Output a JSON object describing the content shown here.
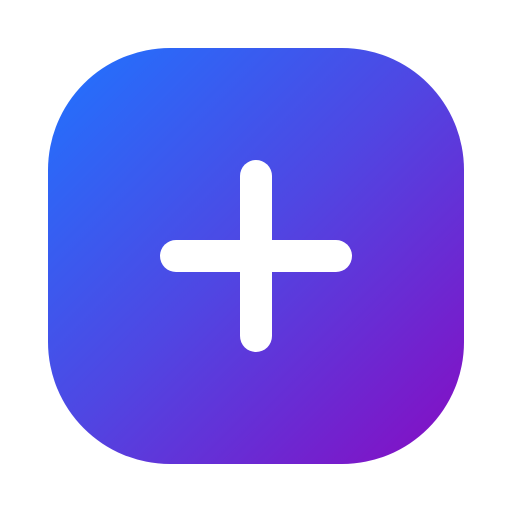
{
  "icon": {
    "name": "plus-icon",
    "gradient_start": "#1F74FF",
    "gradient_mid": "#4F47E3",
    "gradient_end": "#870CC2",
    "symbol_color": "#FFFFFF"
  }
}
